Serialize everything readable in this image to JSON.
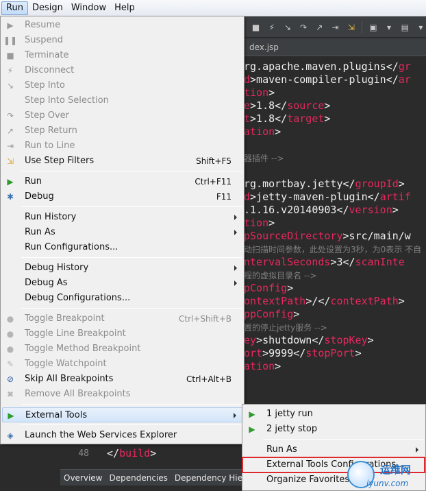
{
  "menubar": {
    "items": [
      "Run",
      "Design",
      "Window",
      "Help"
    ]
  },
  "editor": {
    "tab_label": "dex.jsp",
    "lines": [
      {
        "parts": [
          {
            "t": "rg.apache.maven.plugins</",
            "c": "txt"
          },
          {
            "t": "gr",
            "c": "tag"
          }
        ]
      },
      {
        "parts": [
          {
            "t": "d",
            "c": "tag"
          },
          {
            "t": ">maven-compiler-plugin</",
            "c": "txt"
          },
          {
            "t": "ar",
            "c": "tag"
          }
        ]
      },
      {
        "parts": [
          {
            "t": "tion",
            "c": "tag"
          },
          {
            "t": ">",
            "c": "txt"
          }
        ]
      },
      {
        "parts": [
          {
            "t": "e",
            "c": "tag"
          },
          {
            "t": ">1.8</",
            "c": "txt"
          },
          {
            "t": "source",
            "c": "tag"
          },
          {
            "t": ">",
            "c": "txt"
          }
        ]
      },
      {
        "parts": [
          {
            "t": "t",
            "c": "tag"
          },
          {
            "t": ">1.8</",
            "c": "txt"
          },
          {
            "t": "target",
            "c": "tag"
          },
          {
            "t": ">",
            "c": "txt"
          }
        ]
      },
      {
        "parts": [
          {
            "t": "ation",
            "c": "tag"
          },
          {
            "t": ">",
            "c": "txt"
          }
        ]
      },
      {
        "parts": []
      },
      {
        "parts": [
          {
            "t": "器插件 -->",
            "c": "cmt"
          }
        ]
      },
      {
        "parts": []
      },
      {
        "parts": [
          {
            "t": "rg.mortbay.jetty</",
            "c": "txt"
          },
          {
            "t": "groupId",
            "c": "tag"
          },
          {
            "t": ">",
            "c": "txt"
          }
        ]
      },
      {
        "parts": [
          {
            "t": "d",
            "c": "tag"
          },
          {
            "t": ">jetty-maven-plugin</",
            "c": "txt"
          },
          {
            "t": "artif",
            "c": "tag"
          }
        ]
      },
      {
        "parts": [
          {
            "t": ".1.16.v20140903</",
            "c": "txt"
          },
          {
            "t": "version",
            "c": "tag"
          },
          {
            "t": ">",
            "c": "txt"
          }
        ]
      },
      {
        "parts": [
          {
            "t": "tion",
            "c": "tag"
          },
          {
            "t": ">",
            "c": "txt"
          }
        ]
      },
      {
        "parts": [
          {
            "t": "pSourceDirectory",
            "c": "tag"
          },
          {
            "t": ">src/main/w",
            "c": "txt"
          }
        ]
      },
      {
        "parts": [
          {
            "t": "动扫描时间参数，此处设置为3秒，为0表示 不自",
            "c": "cmt"
          }
        ]
      },
      {
        "parts": [
          {
            "t": "ntervalSeconds",
            "c": "tag"
          },
          {
            "t": ">3</",
            "c": "txt"
          },
          {
            "t": "scanInte",
            "c": "tag"
          }
        ]
      },
      {
        "parts": [
          {
            "t": "程的虚拟目录名 -->",
            "c": "cmt"
          }
        ]
      },
      {
        "parts": [
          {
            "t": "pConfig",
            "c": "tag"
          },
          {
            "t": ">",
            "c": "txt"
          }
        ]
      },
      {
        "parts": [
          {
            "t": "ontextPath",
            "c": "tag"
          },
          {
            "t": ">/</",
            "c": "txt"
          },
          {
            "t": "contextPath",
            "c": "tag"
          },
          {
            "t": ">",
            "c": "txt"
          }
        ]
      },
      {
        "parts": [
          {
            "t": "ppConfig",
            "c": "tag"
          },
          {
            "t": ">",
            "c": "txt"
          }
        ]
      },
      {
        "parts": [
          {
            "t": "置的停止jetty服务 -->",
            "c": "cmt"
          }
        ]
      },
      {
        "parts": [
          {
            "t": "ey",
            "c": "tag"
          },
          {
            "t": ">shutdown</",
            "c": "txt"
          },
          {
            "t": "stopKey",
            "c": "tag"
          },
          {
            "t": ">",
            "c": "txt"
          }
        ]
      },
      {
        "parts": [
          {
            "t": "ort",
            "c": "tag"
          },
          {
            "t": ">9999</",
            "c": "txt"
          },
          {
            "t": "stopPort",
            "c": "tag"
          },
          {
            "t": ">",
            "c": "txt"
          }
        ]
      },
      {
        "parts": [
          {
            "t": "ation",
            "c": "tag"
          },
          {
            "t": ">",
            "c": "txt"
          }
        ]
      }
    ],
    "line_number": "48",
    "bottom_code_open": "</",
    "bottom_code_tag": "build",
    "bottom_code_close": ">",
    "bottom_tabs": [
      "Overview",
      "Dependencies",
      "Dependency Hiera"
    ]
  },
  "run_menu": {
    "items": [
      {
        "label": "Resume",
        "shortcut": "",
        "disabled": true,
        "submenu": false,
        "icon": "resume-icon"
      },
      {
        "label": "Suspend",
        "shortcut": "",
        "disabled": true,
        "submenu": false,
        "icon": "suspend-icon"
      },
      {
        "label": "Terminate",
        "shortcut": "",
        "disabled": true,
        "submenu": false,
        "icon": "terminate-icon"
      },
      {
        "label": "Disconnect",
        "shortcut": "",
        "disabled": true,
        "submenu": false,
        "icon": "disconnect-icon"
      },
      {
        "label": "Step Into",
        "shortcut": "",
        "disabled": true,
        "submenu": false,
        "icon": "step-into-icon"
      },
      {
        "label": "Step Into Selection",
        "shortcut": "",
        "disabled": true,
        "submenu": false,
        "icon": ""
      },
      {
        "label": "Step Over",
        "shortcut": "",
        "disabled": true,
        "submenu": false,
        "icon": "step-over-icon"
      },
      {
        "label": "Step Return",
        "shortcut": "",
        "disabled": true,
        "submenu": false,
        "icon": "step-return-icon"
      },
      {
        "label": "Run to Line",
        "shortcut": "",
        "disabled": true,
        "submenu": false,
        "icon": "run-to-line-icon"
      },
      {
        "label": "Use Step Filters",
        "shortcut": "Shift+F5",
        "disabled": false,
        "submenu": false,
        "icon": "step-filters-icon"
      },
      {
        "sep": true
      },
      {
        "label": "Run",
        "shortcut": "Ctrl+F11",
        "disabled": false,
        "submenu": false,
        "icon": "run-icon"
      },
      {
        "label": "Debug",
        "shortcut": "F11",
        "disabled": false,
        "submenu": false,
        "icon": "debug-icon"
      },
      {
        "sep": true
      },
      {
        "label": "Run History",
        "shortcut": "",
        "disabled": false,
        "submenu": true,
        "icon": ""
      },
      {
        "label": "Run As",
        "shortcut": "",
        "disabled": false,
        "submenu": true,
        "icon": ""
      },
      {
        "label": "Run Configurations...",
        "shortcut": "",
        "disabled": false,
        "submenu": false,
        "icon": ""
      },
      {
        "sep": true
      },
      {
        "label": "Debug History",
        "shortcut": "",
        "disabled": false,
        "submenu": true,
        "icon": ""
      },
      {
        "label": "Debug As",
        "shortcut": "",
        "disabled": false,
        "submenu": true,
        "icon": ""
      },
      {
        "label": "Debug Configurations...",
        "shortcut": "",
        "disabled": false,
        "submenu": false,
        "icon": ""
      },
      {
        "sep": true
      },
      {
        "label": "Toggle Breakpoint",
        "shortcut": "Ctrl+Shift+B",
        "disabled": true,
        "submenu": false,
        "icon": "breakpoint-icon"
      },
      {
        "label": "Toggle Line Breakpoint",
        "shortcut": "",
        "disabled": true,
        "submenu": false,
        "icon": "line-breakpoint-icon"
      },
      {
        "label": "Toggle Method Breakpoint",
        "shortcut": "",
        "disabled": true,
        "submenu": false,
        "icon": "method-breakpoint-icon"
      },
      {
        "label": "Toggle Watchpoint",
        "shortcut": "",
        "disabled": true,
        "submenu": false,
        "icon": "watchpoint-icon"
      },
      {
        "label": "Skip All Breakpoints",
        "shortcut": "Ctrl+Alt+B",
        "disabled": false,
        "submenu": false,
        "icon": "skip-breakpoints-icon"
      },
      {
        "label": "Remove All Breakpoints",
        "shortcut": "",
        "disabled": true,
        "submenu": false,
        "icon": "remove-breakpoints-icon"
      },
      {
        "sep": true
      },
      {
        "label": "External Tools",
        "shortcut": "",
        "disabled": false,
        "submenu": true,
        "icon": "external-tools-icon",
        "highlight": true
      },
      {
        "sep": true
      },
      {
        "label": "Launch the Web Services Explorer",
        "shortcut": "",
        "disabled": false,
        "submenu": false,
        "icon": "web-services-icon"
      }
    ]
  },
  "tools_menu": {
    "items": [
      {
        "label": "1 jetty run",
        "submenu": false,
        "icon": "external-tool-run-icon"
      },
      {
        "label": "2 jetty stop",
        "submenu": false,
        "icon": "external-tool-run-icon"
      },
      {
        "sep": true
      },
      {
        "label": "Run As",
        "submenu": true,
        "icon": ""
      },
      {
        "label": "External Tools Configurations...",
        "submenu": false,
        "icon": ""
      },
      {
        "label": "Organize Favorites...",
        "submenu": false,
        "icon": ""
      }
    ]
  },
  "watermark": {
    "cn": "运维网",
    "url": "iyunv.com"
  }
}
